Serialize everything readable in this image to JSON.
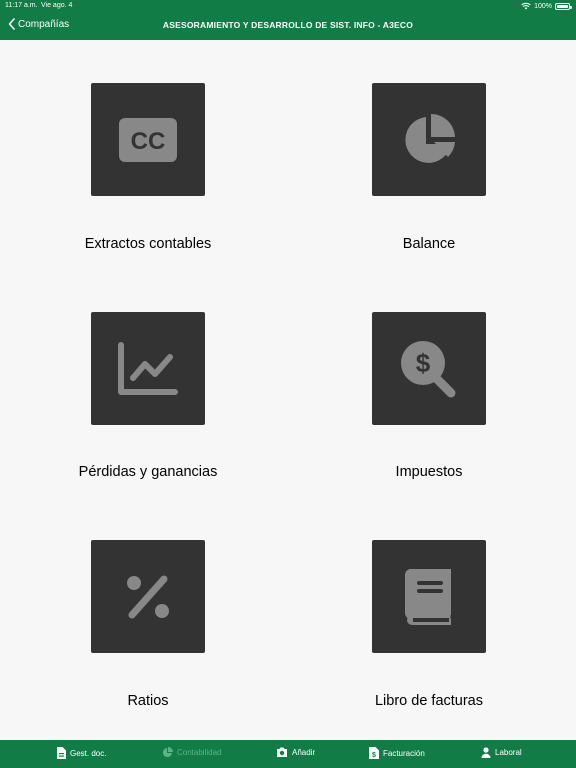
{
  "status_bar": {
    "time": "11:17 a.m.",
    "date": "Vie ago. 4",
    "battery": "100%",
    "battery_level": 1.0
  },
  "nav": {
    "back_label": "Compañías",
    "title": "ASESORAMIENTO Y DESARROLLO DE SIST. INFO - A3ECO"
  },
  "colors": {
    "brand_green": "#127c46",
    "tile_bg": "#333333",
    "icon_gray": "#888888",
    "tab_disabled": "#5bb389"
  },
  "tiles": [
    {
      "label": "Extractos contables",
      "icon": "cc-icon",
      "icon_text": "CC"
    },
    {
      "label": "Balance",
      "icon": "pie-chart-icon"
    },
    {
      "label": "Pérdidas y ganancias",
      "icon": "line-chart-icon"
    },
    {
      "label": "Impuestos",
      "icon": "dollar-search-icon"
    },
    {
      "label": "Ratios",
      "icon": "percent-icon"
    },
    {
      "label": "Libro de facturas",
      "icon": "book-icon"
    }
  ],
  "tabbar": {
    "items": [
      {
        "label": "Gest. doc.",
        "icon": "document-icon",
        "enabled": true
      },
      {
        "label": "Contabilidad",
        "icon": "pie-icon",
        "enabled": false
      },
      {
        "label": "Añadir",
        "icon": "camera-icon",
        "enabled": true
      },
      {
        "label": "Facturación",
        "icon": "invoice-icon",
        "enabled": true
      },
      {
        "label": "Laboral",
        "icon": "person-icon",
        "enabled": true
      }
    ]
  }
}
